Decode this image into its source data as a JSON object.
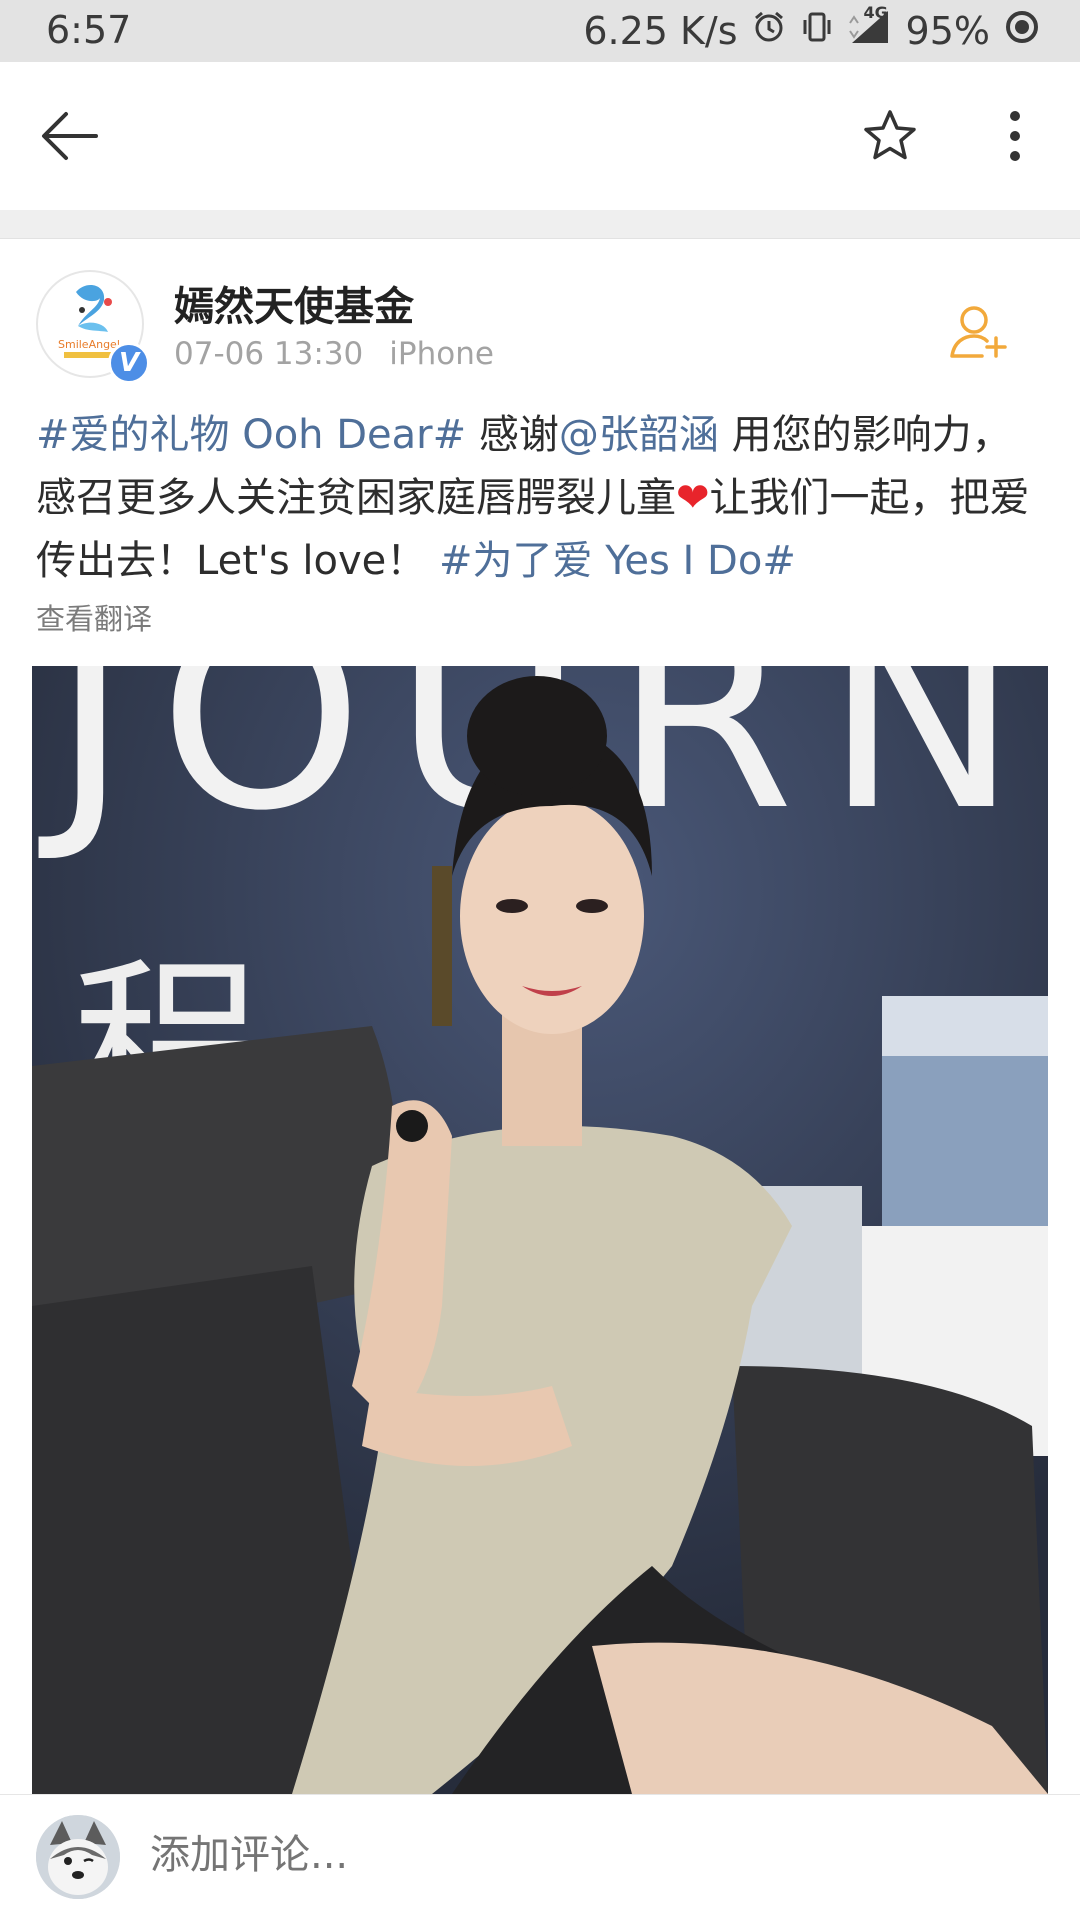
{
  "status_bar": {
    "time": "6:57",
    "net_speed": "6.25 K/s",
    "network": "4G",
    "battery": "95%"
  },
  "post": {
    "author": "嫣然天使基金",
    "date": "07-06 13:30",
    "source": "iPhone",
    "text": {
      "tag1": "#爱的礼物 Ooh Dear#",
      "part1": " 感谢",
      "mention": "@张韶涵",
      "part2": " 用您的影响力，感召更多人关注贫困家庭唇腭裂儿童",
      "heart": "❤",
      "part3": "让我们一起，把爱传出去！Let's love！ ",
      "tag2": "#为了爱 Yes I Do#"
    },
    "translate_label": "查看翻译",
    "image_text": {
      "banner": "JOURN",
      "cn_char": "程"
    },
    "avatar_text": "SmileAngel"
  },
  "comment_bar": {
    "placeholder": "添加评论..."
  },
  "colors": {
    "link": "#4f6f99",
    "follow_icon": "#f2a93b",
    "verified_badge": "#4d8ee6"
  }
}
